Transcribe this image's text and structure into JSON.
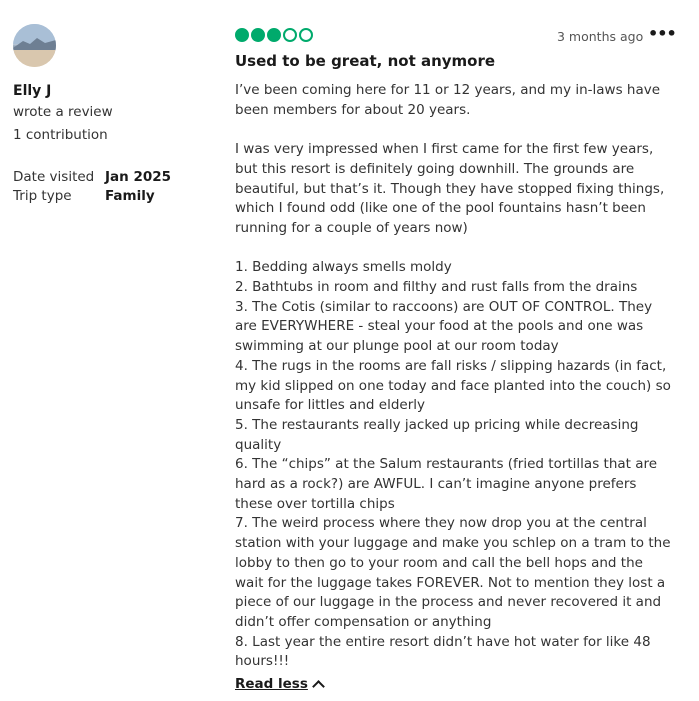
{
  "reviewer": {
    "name": "Elly J",
    "action": "wrote a review",
    "contributions": "1 contribution",
    "date_visited_label": "Date visited",
    "date_visited": "Jan 2025",
    "trip_type_label": "Trip type",
    "trip_type": "Family"
  },
  "review": {
    "rating": 3,
    "rating_max": 5,
    "rating_color": "#00aa6c",
    "posted": "3 months ago",
    "more_icon": "more-horizontal-icon",
    "title": "Used to be great, not anymore",
    "paragraphs": [
      "I’ve been coming here for 11 or 12 years, and my in-laws have been members for about 20 years.",
      "",
      "I was very impressed when I first came for the first few years, but this resort is definitely going downhill. The grounds are beautiful, but that’s it. Though they have stopped fixing things, which I found odd (like one of the pool fountains hasn’t been running for a couple of years now)",
      "",
      "1. Bedding always smells moldy",
      "2. Bathtubs in room and filthy and rust falls from the drains",
      "3. The Cotis (similar to raccoons) are OUT OF CONTROL. They are EVERYWHERE - steal your food at the pools and one was swimming at our plunge pool at our room today",
      "4. The rugs in the rooms are fall risks / slipping hazards (in fact, my kid slipped on one today and face planted into the couch) so unsafe for littles and elderly",
      "5. The restaurants really jacked up pricing while decreasing quality",
      "6. The “chips” at the Salum restaurants (fried tortillas that are hard as a rock?) are AWFUL. I can’t imagine anyone prefers these over tortilla chips",
      "7. The weird process where they now drop you at the central station with your luggage and make you schlep on a tram to the lobby to then go to your room and call the bell hops and the  wait for the luggage takes FOREVER. Not to mention they lost a piece of our luggage in the process and never recovered it and didn’t offer compensation or anything",
      "8. Last year the entire resort didn’t have hot water for like 48 hours!!!"
    ],
    "read_less": "Read less",
    "read_less_icon": "chevron-up-icon"
  }
}
